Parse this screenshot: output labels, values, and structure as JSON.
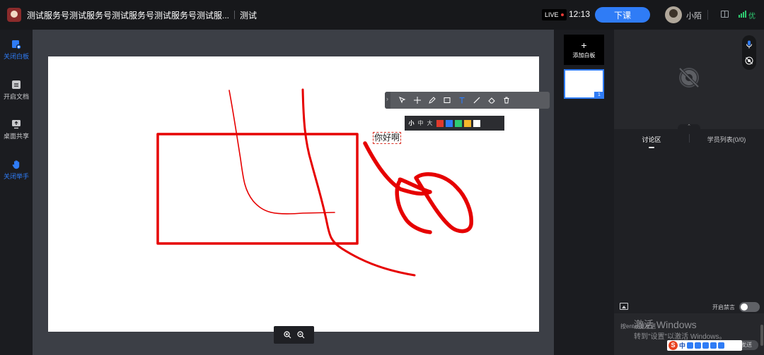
{
  "header": {
    "course_title": "测试服务号测试服务号测试服务号测试服务号测试服...",
    "subtitle": "测试",
    "live_label": "LIVE",
    "timer": "12:13",
    "end_button": "下课",
    "user_name": "小陌",
    "network_label": "优",
    "colors": {
      "accent": "#2f7cf6",
      "network": "#2ecc71"
    }
  },
  "leftnav": {
    "items": [
      {
        "label": "关闭白板",
        "icon": "whiteboard-icon",
        "active": true
      },
      {
        "label": "开启文档",
        "icon": "document-icon",
        "active": false
      },
      {
        "label": "桌面共享",
        "icon": "screen-share-icon",
        "active": false
      },
      {
        "label": "关闭举手",
        "icon": "raise-hand-icon",
        "active": true
      }
    ]
  },
  "whiteboard": {
    "text_note": "你好啊",
    "toolbar_tools": [
      "select-tool-icon",
      "laser-pointer-icon",
      "pen-tool-icon",
      "rectangle-tool-icon",
      "text-tool-icon",
      "line-tool-icon",
      "eraser-tool-icon",
      "delete-tool-icon"
    ],
    "active_tool": "text-tool-icon",
    "text_sizes": [
      "小",
      "中",
      "大"
    ],
    "active_size": "小",
    "colors": [
      "#e03a2c",
      "#2f7cf6",
      "#2ecc71",
      "#f5b72b",
      "#ffffff"
    ],
    "stroke_color": "#e60000"
  },
  "thumbnails": {
    "add_label": "添加白板",
    "add_icon": "+",
    "pages": [
      {
        "number": "1"
      }
    ]
  },
  "sidebar": {
    "tabs": [
      {
        "label": "讨论区",
        "active": true
      },
      {
        "label": "学员列表(0/0)",
        "active": false
      }
    ],
    "mute_label": "开启禁言",
    "mute_on": false,
    "input_hint": "按enter键发送",
    "send_button": "发送"
  },
  "system": {
    "activate_title": "激活 Windows",
    "activate_sub": "转到\"设置\"以激活 Windows。",
    "ime_logo": "S",
    "ime_lang": "中"
  }
}
